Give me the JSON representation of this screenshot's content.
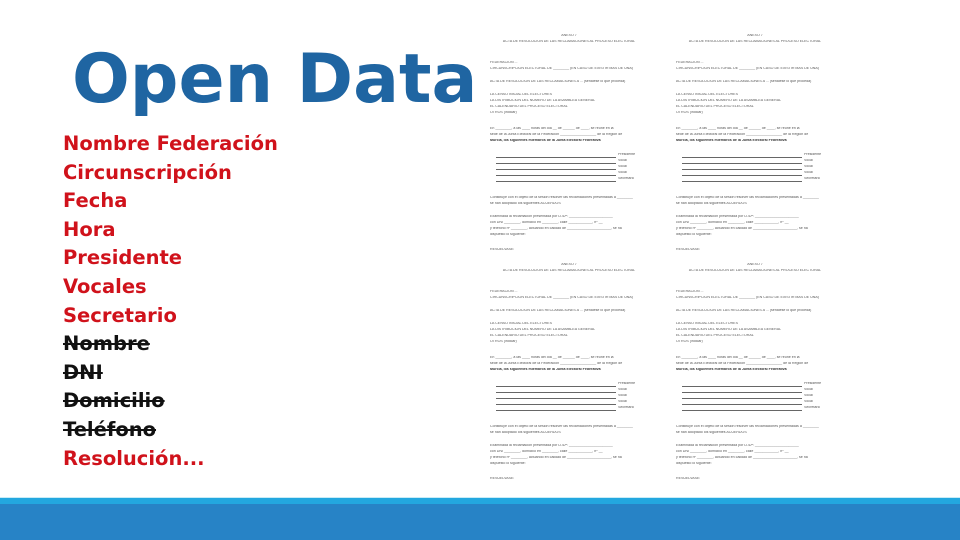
{
  "slide": {
    "title": "Open Data",
    "fields": [
      {
        "label": "Nombre Federación",
        "struck": false
      },
      {
        "label": "Circunscripción",
        "struck": false
      },
      {
        "label": "Fecha",
        "struck": false
      },
      {
        "label": "Hora",
        "struck": false
      },
      {
        "label": "Presidente",
        "struck": false
      },
      {
        "label": "Vocales",
        "struck": false
      },
      {
        "label": "Secretario",
        "struck": false
      },
      {
        "label": "Nombre",
        "struck": true
      },
      {
        "label": "DNI",
        "struck": true
      },
      {
        "label": "Domicilio",
        "struck": true
      },
      {
        "label": "Teléfono",
        "struck": true
      },
      {
        "label": "Resolución...",
        "struck": false
      }
    ],
    "colors": {
      "title": "#1f65a2",
      "field": "#d0121b",
      "struck_field": "#111111",
      "footer_bar": "#2783c6",
      "footer_accent": "#23a7df"
    }
  },
  "document": {
    "annex": "ANEXO 7",
    "heading": "ACTA DE RESOLUCIÓN DE LAS RECLAMACIONES AL PROCESO ELECTORAL",
    "federation_label": "FEDERACIÓN ...",
    "circ_label": "CIRCUNSCRIPCIÓN ELECTORAL DE ________ (EN CASO DE EXISTIR MÁS DE UNA)",
    "section_label": "ACTA DE RESOLUCIÓN DE LAS RECLAMACIONES A ... (señálese lo que proceda)",
    "options": [
      "LA CENSO INICIAL DEL ELECTORES",
      "LA DISTRIBUCIÓN DEL NÚMERO DE LA ASAMBLEA GENERAL",
      "EL CALENDARIO DEL PROCESO ELECTORAL",
      "OTROS (indicar)"
    ],
    "intro_line1": "En ________, a las ____ horas del día __ de ______ de ____, se reúne en la",
    "intro_line2": "sede de la Junta Electoral de la Federación __________________ de la Región de",
    "intro_line3": "Murcia, los siguientes miembros de la Junta Electoral Federativa",
    "members": [
      "Presidente",
      "Vocal",
      "Vocal",
      "Vocal",
      "Secretario"
    ],
    "resolution_line1": "Constituye con el objeto de la sesión resolver las reclamaciones presentadas a ________",
    "resolution_line2": "se han adoptado los siguientes ACUERDOS",
    "claim_line1": "Examinada la reclamación presentada por D./Dª: ______________________",
    "claim_line2": "con DNI ________, domicilio en ________, calle ____________, nº __",
    "claim_line3": "y teléfono nº ________, actuando en calidad de ______________________, se ha",
    "claim_line4": "dispuesto lo siguiente:",
    "footer_label": "RESUELVASE:"
  }
}
